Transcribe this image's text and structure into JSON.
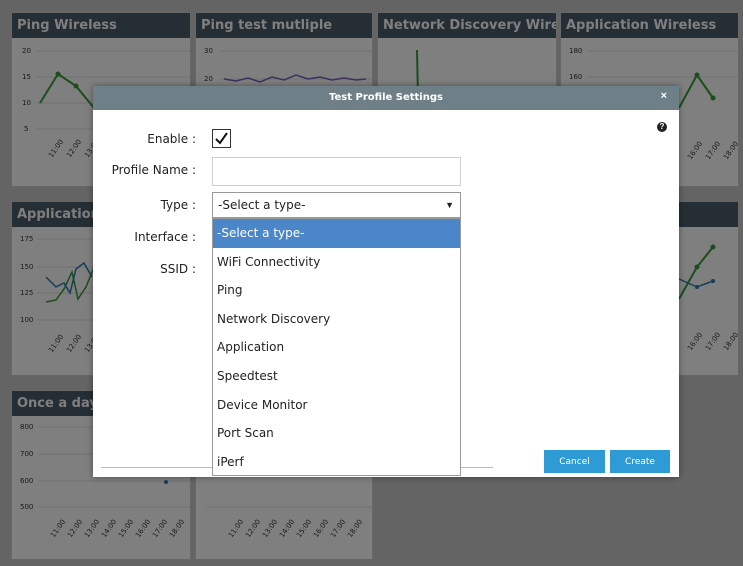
{
  "dashboard": {
    "cards": [
      {
        "title": "Ping Wireless",
        "yticks": [
          "20",
          "15",
          "10",
          "5"
        ],
        "xticks": [
          "11:00",
          "12:00",
          "13:00"
        ]
      },
      {
        "title": "Ping test mutliple",
        "yticks": [
          "30",
          "20"
        ],
        "xticks": []
      },
      {
        "title": "Network Discovery Wirele...",
        "yticks": [],
        "xticks": []
      },
      {
        "title": "Application Wireless",
        "yticks": [
          "180",
          "160"
        ],
        "xticks": [
          "16:00",
          "17:00",
          "18:00"
        ]
      },
      {
        "title": "Application t",
        "yticks": [
          "175",
          "150",
          "125",
          "100"
        ],
        "xticks": [
          "11:00",
          "12:00",
          "13:00"
        ]
      },
      {
        "title": "",
        "yticks": [],
        "xticks": [
          "16:00",
          "17:00",
          "18:00"
        ]
      },
      {
        "title": "Once a day s",
        "yticks": [
          "800",
          "700",
          "600",
          "500"
        ],
        "xticks": [
          "11:00",
          "12:00",
          "13:00",
          "14:00",
          "15:00",
          "16:00",
          "17:00",
          "18:00"
        ]
      },
      {
        "title": "",
        "yticks": [],
        "xticks": [
          "11:00",
          "12:00",
          "13:00",
          "14:00",
          "15:00",
          "16:00",
          "17:00",
          "18:00"
        ]
      }
    ]
  },
  "modal": {
    "title": "Test Profile Settings",
    "close_symbol": "×",
    "help_symbol": "?",
    "labels": {
      "enable": "Enable :",
      "profile_name": "Profile Name :",
      "type": "Type :",
      "interface": "Interface :",
      "ssid": "SSID :"
    },
    "enable_checked": true,
    "profile_name_value": "",
    "type_selected": "-Select a type-",
    "type_options": [
      "-Select a type-",
      "WiFi Connectivity",
      "Ping",
      "Network Discovery",
      "Application",
      "Speedtest",
      "Device Monitor",
      "Port Scan",
      "iPerf"
    ],
    "buttons": {
      "cancel": "Cancel",
      "create": "Create"
    }
  },
  "colors": {
    "card_header": "#4b5d6b",
    "modal_header": "#6f7f88",
    "button": "#2f9bd6",
    "selected_option": "#4a86c8",
    "series_green": "#3a9a3a",
    "series_blue": "#2a7ab8",
    "series_purple": "#7a5fc0"
  }
}
